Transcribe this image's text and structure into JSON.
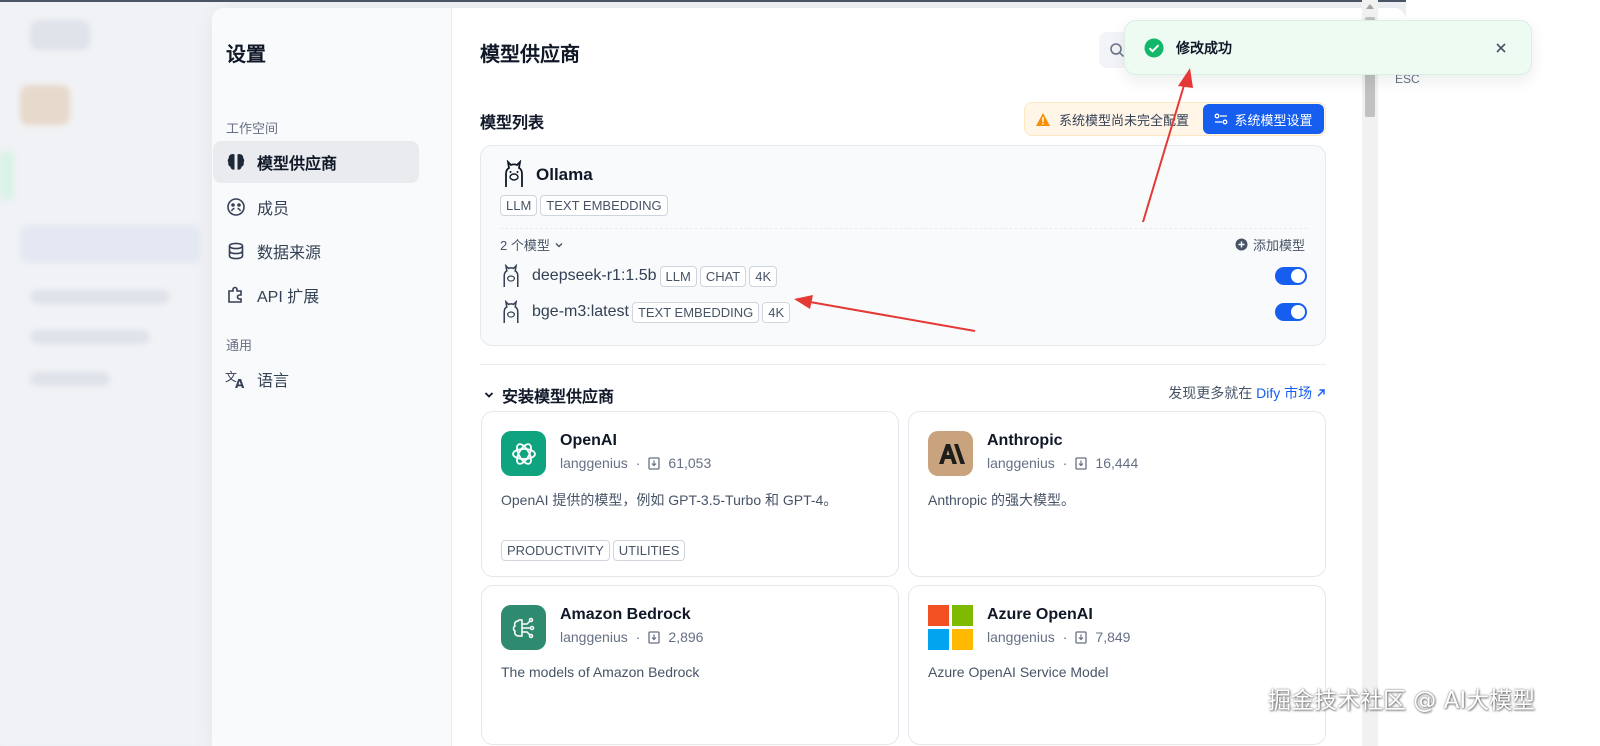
{
  "settings": {
    "title": "设置",
    "workspace_group": "工作空间",
    "general_group": "通用",
    "nav": [
      {
        "label": "模型供应商",
        "icon": "brain-icon",
        "active": true
      },
      {
        "label": "成员",
        "icon": "members-icon",
        "active": false
      },
      {
        "label": "数据来源",
        "icon": "database-icon",
        "active": false
      },
      {
        "label": "API 扩展",
        "icon": "puzzle-icon",
        "active": false
      }
    ],
    "language_label": "语言"
  },
  "main": {
    "title": "模型供应商",
    "model_list_label": "模型列表",
    "warning_text": "系统模型尚未完全配置",
    "system_model_button": "系统模型设置",
    "ollama": {
      "name": "Ollama",
      "tags": [
        "LLM",
        "TEXT EMBEDDING"
      ],
      "model_count": "2 个模型",
      "add_model": "添加模型",
      "models": [
        {
          "name": "deepseek-r1:1.5b",
          "tags": [
            "LLM",
            "CHAT",
            "4K"
          ],
          "enabled": true
        },
        {
          "name": "bge-m3:latest",
          "tags": [
            "TEXT EMBEDDING",
            "4K"
          ],
          "enabled": true
        }
      ]
    },
    "install_title": "安装模型供应商",
    "market_prefix": "发现更多就在 ",
    "market_link": "Dify 市场",
    "providers": [
      {
        "name": "OpenAI",
        "org": "langgenius",
        "downloads": "61,053",
        "desc": "OpenAI 提供的模型，例如 GPT-3.5-Turbo 和 GPT-4。",
        "tags": [
          "PRODUCTIVITY",
          "UTILITIES"
        ],
        "color": "#10a37f"
      },
      {
        "name": "Anthropic",
        "org": "langgenius",
        "downloads": "16,444",
        "desc": "Anthropic 的强大模型。",
        "tags": [],
        "color": "#c9a27e"
      },
      {
        "name": "Amazon Bedrock",
        "org": "langgenius",
        "downloads": "2,896",
        "desc": "The models of Amazon Bedrock",
        "tags": [],
        "color": "#2e8b6f"
      },
      {
        "name": "Azure OpenAI",
        "org": "langgenius",
        "downloads": "7,849",
        "desc": "Azure OpenAI Service Model",
        "tags": [],
        "color": "#f25022"
      }
    ]
  },
  "esc_label": "ESC",
  "toast": {
    "message": "修改成功",
    "accent": "#12b76a"
  },
  "watermark": "掘金技术社区 @ AI大模型",
  "colors": {
    "primary": "#155eef",
    "warning": "#f79009",
    "annotation": "#e53935"
  }
}
